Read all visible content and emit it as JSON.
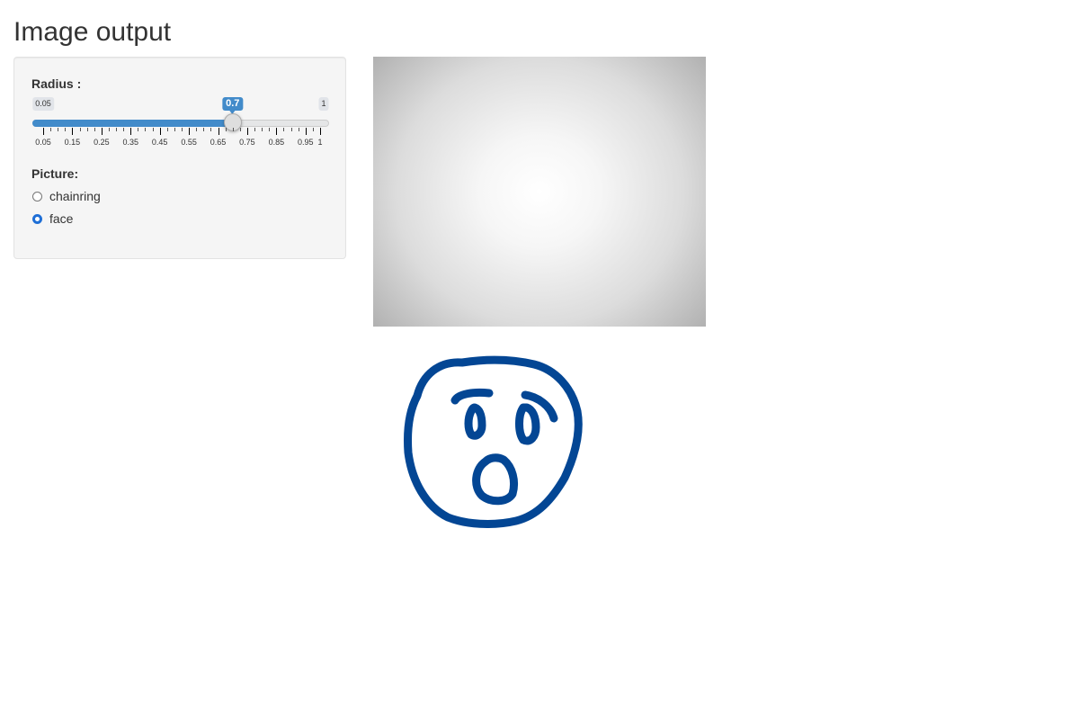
{
  "page": {
    "title": "Image output"
  },
  "radius": {
    "label": "Radius :",
    "min_label": "0.05",
    "max_label": "1",
    "min": 0.05,
    "max": 1,
    "value": 0.7,
    "value_label": "0.7",
    "tick_labels": [
      "0.05",
      "0.15",
      "0.25",
      "0.35",
      "0.45",
      "0.55",
      "0.65",
      "0.75",
      "0.85",
      "0.95",
      "1"
    ],
    "accent_color": "#428bca"
  },
  "picture": {
    "label": "Picture:",
    "options": [
      {
        "label": "chainring",
        "selected": false
      },
      {
        "label": "face",
        "selected": true
      }
    ],
    "selected_color": "#1f6fd6"
  },
  "outputs": {
    "gradient_image": "radial-gradient-icon",
    "face_image": "face-drawing-icon",
    "face_stroke_color": "#034694"
  }
}
